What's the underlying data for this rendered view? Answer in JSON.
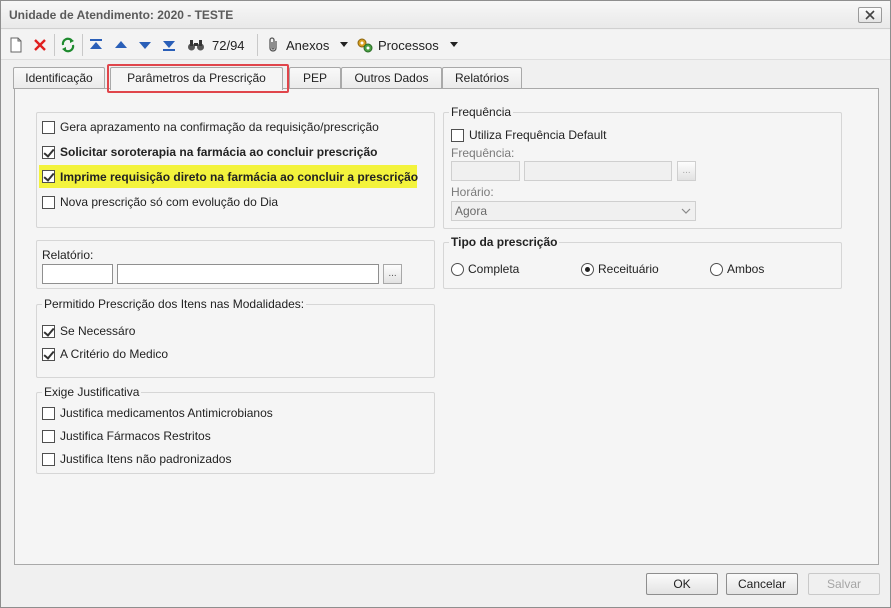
{
  "window": {
    "title": "Unidade de Atendimento: 2020 - TESTE"
  },
  "toolbar": {
    "record_counter": "72/94",
    "anexos_label": "Anexos",
    "processos_label": "Processos"
  },
  "tabs": [
    {
      "label": "Identificação"
    },
    {
      "label": "Parâmetros da Prescrição"
    },
    {
      "label": "PEP"
    },
    {
      "label": "Outros Dados"
    },
    {
      "label": "Relatórios"
    }
  ],
  "options": {
    "items": [
      {
        "label": "Gera aprazamento na confirmação da requisição/prescrição",
        "checked": false
      },
      {
        "label": "Solicitar soroterapia na farmácia ao concluir prescrição",
        "checked": true
      },
      {
        "label": "Imprime requisição direto na farmácia ao concluir a prescrição",
        "checked": true
      },
      {
        "label": "Nova prescrição só com evolução do Dia",
        "checked": false
      }
    ]
  },
  "relatorio": {
    "label": "Relatório:",
    "code_value": "",
    "name_value": "",
    "lookup": "..."
  },
  "modalidades": {
    "title": "Permitido Prescrição dos Itens nas Modalidades:",
    "items": [
      {
        "label": "Se Necessáro",
        "checked": true
      },
      {
        "label": "A Critério do Medico",
        "checked": true
      }
    ]
  },
  "justificativa": {
    "title": "Exige Justificativa",
    "items": [
      {
        "label": "Justifica medicamentos Antimicrobianos",
        "checked": false
      },
      {
        "label": "Justifica Fármacos Restritos",
        "checked": false
      },
      {
        "label": "Justifica Itens não padronizados",
        "checked": false
      }
    ]
  },
  "frequencia": {
    "title": "Frequência",
    "default_label": "Utiliza Frequência Default",
    "frequencia_label": "Frequência:",
    "lookup": "...",
    "horario_label": "Horário:",
    "horario_value": "Agora"
  },
  "tipo_prescricao": {
    "title": "Tipo da prescrição",
    "options": [
      {
        "label": "Completa",
        "selected": false
      },
      {
        "label": "Receituário",
        "selected": true
      },
      {
        "label": "Ambos",
        "selected": false
      }
    ]
  },
  "footer": {
    "ok": "OK",
    "cancel": "Cancelar",
    "save": "Salvar"
  }
}
